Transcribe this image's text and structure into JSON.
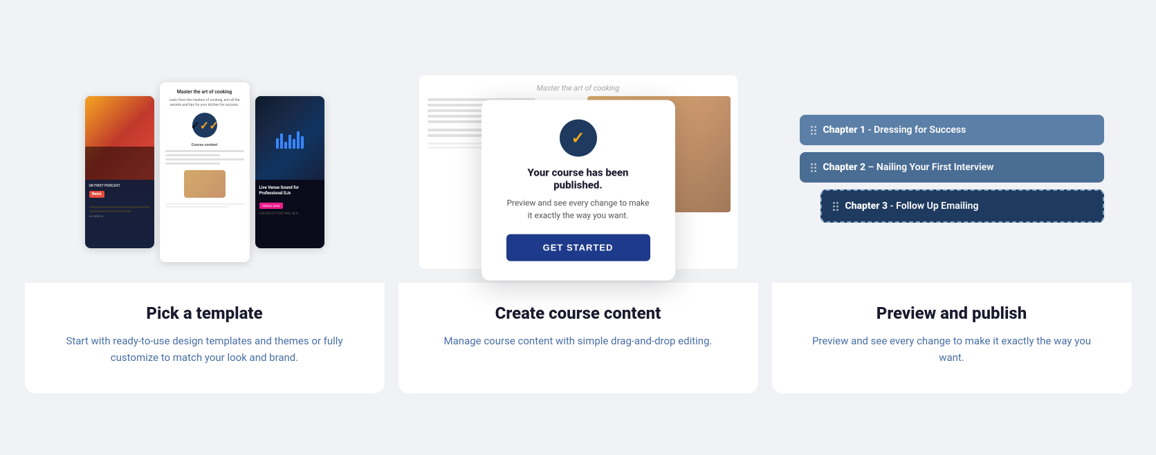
{
  "card1": {
    "heading": "Pick a template",
    "description": "Start with ready-to-use design templates and themes or fully customize to match your look and brand.",
    "preview": {
      "thumb_cooking_title": "Master the art of cooking",
      "thumb_cooking_subtitle": "Learn from the masters of cooking, and all the secrets and tips for your kitchen for success.",
      "thumb_dj_heading": "Live Venue Sound for Professional DJs",
      "thumb_dj_footer": "LIVE BEATS THAT WILL BLO...",
      "podcast_label": "UR FIRST PODCAST",
      "podcast_badge": "AS SEEN IN"
    }
  },
  "card2": {
    "heading": "Create course content",
    "description": "Manage course content with simple drag-and-drop editing.",
    "bg_title": "Master the art of cooking",
    "modal": {
      "title": "Your course has been published.",
      "text": "Preview and see every change to make it exactly the way you want.",
      "button_label": "GET STARTED"
    }
  },
  "card3": {
    "heading": "Preview and publish",
    "description": "Preview and see every change to make it exactly the way you want.",
    "chapters": [
      {
        "id": "ch1",
        "bold": "Chapter 1",
        "rest": " - Dressing for Success"
      },
      {
        "id": "ch2",
        "bold": "Chapter 2",
        "rest": " – Nailing Your First Interview"
      },
      {
        "id": "ch3",
        "bold": "Chapter 3",
        "rest": " - Follow Up Emailing"
      }
    ]
  }
}
